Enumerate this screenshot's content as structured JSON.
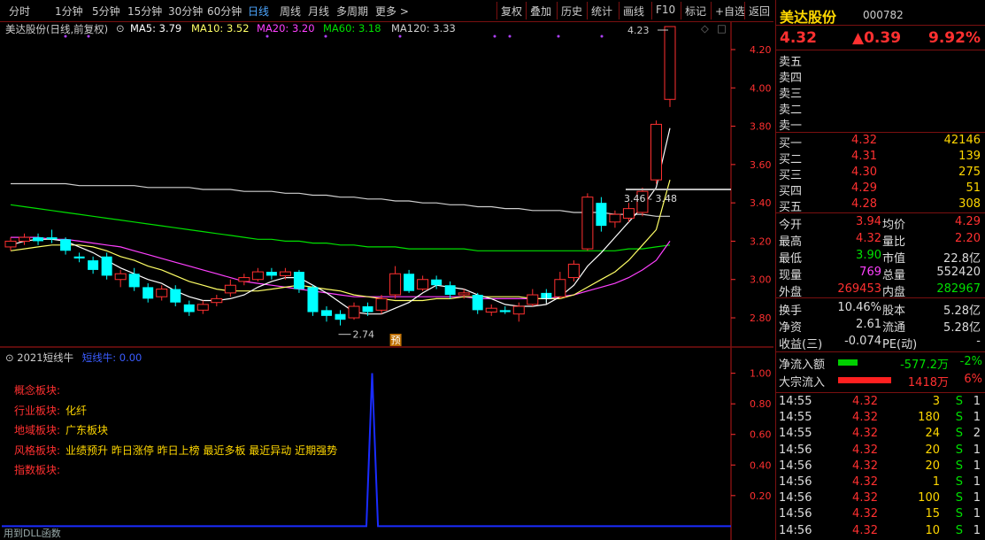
{
  "toolbar": {
    "timeframes": [
      "分时",
      "1分钟",
      "5分钟",
      "15分钟",
      "30分钟",
      "60分钟",
      "日线",
      "周线",
      "月线",
      "多周期",
      "更多 >"
    ],
    "active": "日线",
    "actions": [
      "复权",
      "叠加",
      "历史",
      "统计",
      "画线",
      "F10",
      "标记",
      "+自选",
      "返回"
    ]
  },
  "chart_title": {
    "name": "美达股份(日线,前复权)",
    "ma5": "MA5: 3.79",
    "ma10": "MA10: 3.52",
    "ma20": "MA20: 3.20",
    "ma60": "MA60: 3.18",
    "ma120": "MA120: 3.33"
  },
  "colors": {
    "up": "#ff3030",
    "down": "#00ffff",
    "ma5": "#ffffff",
    "ma10": "#ffff66",
    "ma20": "#ff40ff",
    "ma60": "#00e000",
    "ma120": "#cfcfcf",
    "panel_border": "#7a1010"
  },
  "chart_data": [
    {
      "type": "candlestick",
      "y_ticks": [
        "4.20",
        "4.00",
        "3.80",
        "3.60",
        "3.40",
        "3.20",
        "3.00",
        "2.80"
      ],
      "ylim": [
        2.68,
        4.26
      ],
      "annotations": {
        "high_label": "4.23",
        "low_label": "2.74",
        "level_label": "3.46 - 3.48",
        "marker": "预"
      },
      "candles": [
        [
          3.17,
          3.2,
          3.22,
          3.15
        ],
        [
          3.2,
          3.22,
          3.24,
          3.18
        ],
        [
          3.22,
          3.2,
          3.24,
          3.18
        ],
        [
          3.22,
          3.21,
          3.26,
          3.19
        ],
        [
          3.21,
          3.15,
          3.22,
          3.13
        ],
        [
          3.12,
          3.11,
          3.14,
          3.09
        ],
        [
          3.1,
          3.05,
          3.12,
          3.03
        ],
        [
          3.12,
          3.02,
          3.14,
          3.0
        ],
        [
          3.0,
          3.03,
          3.05,
          2.96
        ],
        [
          3.03,
          2.96,
          3.06,
          2.94
        ],
        [
          2.96,
          2.9,
          2.98,
          2.88
        ],
        [
          2.91,
          2.95,
          2.97,
          2.89
        ],
        [
          2.95,
          2.88,
          2.97,
          2.86
        ],
        [
          2.87,
          2.83,
          2.89,
          2.81
        ],
        [
          2.84,
          2.87,
          2.89,
          2.82
        ],
        [
          2.88,
          2.9,
          2.92,
          2.86
        ],
        [
          2.93,
          2.97,
          3.0,
          2.91
        ],
        [
          2.99,
          3.01,
          3.03,
          2.97
        ],
        [
          3.0,
          3.04,
          3.06,
          2.99
        ],
        [
          3.04,
          3.02,
          3.06,
          3.0
        ],
        [
          3.02,
          3.04,
          3.06,
          3.0
        ],
        [
          3.04,
          2.95,
          3.05,
          2.93
        ],
        [
          2.96,
          2.83,
          2.97,
          2.81
        ],
        [
          2.84,
          2.81,
          2.86,
          2.78
        ],
        [
          2.82,
          2.79,
          2.84,
          2.76
        ],
        [
          2.8,
          2.86,
          2.88,
          2.79
        ],
        [
          2.86,
          2.83,
          2.88,
          2.81
        ],
        [
          2.84,
          2.9,
          2.92,
          2.82
        ],
        [
          2.92,
          3.03,
          3.07,
          2.9
        ],
        [
          3.03,
          2.94,
          3.05,
          2.93
        ],
        [
          2.95,
          3.0,
          3.02,
          2.94
        ],
        [
          3.0,
          2.97,
          3.02,
          2.95
        ],
        [
          2.97,
          2.92,
          2.99,
          2.9
        ],
        [
          2.92,
          2.93,
          2.95,
          2.9
        ],
        [
          2.92,
          2.84,
          2.93,
          2.82
        ],
        [
          2.83,
          2.85,
          2.87,
          2.81
        ],
        [
          2.84,
          2.83,
          2.86,
          2.82
        ],
        [
          2.82,
          2.86,
          2.88,
          2.78
        ],
        [
          2.87,
          2.92,
          2.95,
          2.86
        ],
        [
          2.93,
          2.9,
          2.95,
          2.88
        ],
        [
          2.91,
          3.0,
          3.04,
          2.9
        ],
        [
          3.01,
          3.08,
          3.1,
          2.99
        ],
        [
          3.16,
          3.43,
          3.45,
          3.15
        ],
        [
          3.4,
          3.28,
          3.43,
          3.25
        ],
        [
          3.3,
          3.34,
          3.36,
          3.27
        ],
        [
          3.32,
          3.37,
          3.4,
          3.3
        ],
        [
          3.35,
          3.46,
          3.48,
          3.33
        ],
        [
          3.52,
          3.81,
          3.83,
          3.5
        ],
        [
          3.94,
          4.32,
          4.32,
          3.9
        ]
      ],
      "ma": {
        "ma5": [
          3.18,
          3.2,
          3.21,
          3.21,
          3.2,
          3.17,
          3.14,
          3.1,
          3.06,
          3.03,
          3.0,
          2.98,
          2.94,
          2.91,
          2.89,
          2.89,
          2.9,
          2.92,
          2.96,
          2.99,
          3.01,
          3.01,
          2.97,
          2.93,
          2.88,
          2.83,
          2.82,
          2.82,
          2.85,
          2.88,
          2.93,
          2.97,
          2.96,
          2.95,
          2.92,
          2.9,
          2.87,
          2.86,
          2.86,
          2.87,
          2.91,
          2.97,
          3.07,
          3.14,
          3.22,
          3.3,
          3.38,
          3.48,
          3.79
        ],
        "ma10": [
          3.15,
          3.16,
          3.17,
          3.18,
          3.18,
          3.18,
          3.17,
          3.15,
          3.12,
          3.1,
          3.07,
          3.05,
          3.02,
          2.99,
          2.97,
          2.95,
          2.94,
          2.94,
          2.94,
          2.95,
          2.96,
          2.97,
          2.96,
          2.95,
          2.94,
          2.92,
          2.91,
          2.9,
          2.89,
          2.89,
          2.89,
          2.9,
          2.9,
          2.91,
          2.91,
          2.91,
          2.91,
          2.91,
          2.9,
          2.9,
          2.9,
          2.92,
          2.96,
          3.0,
          3.04,
          3.1,
          3.18,
          3.26,
          3.52
        ],
        "ma20": [
          3.22,
          3.22,
          3.22,
          3.21,
          3.21,
          3.2,
          3.19,
          3.18,
          3.17,
          3.15,
          3.13,
          3.11,
          3.09,
          3.07,
          3.05,
          3.03,
          3.01,
          2.99,
          2.98,
          2.97,
          2.96,
          2.95,
          2.94,
          2.93,
          2.92,
          2.91,
          2.91,
          2.91,
          2.91,
          2.91,
          2.91,
          2.91,
          2.91,
          2.91,
          2.9,
          2.9,
          2.9,
          2.9,
          2.9,
          2.9,
          2.91,
          2.92,
          2.94,
          2.96,
          2.98,
          3.01,
          3.05,
          3.1,
          3.2
        ],
        "ma60": [
          3.39,
          3.38,
          3.37,
          3.36,
          3.35,
          3.34,
          3.33,
          3.32,
          3.31,
          3.3,
          3.29,
          3.28,
          3.27,
          3.26,
          3.25,
          3.24,
          3.23,
          3.22,
          3.21,
          3.21,
          3.2,
          3.2,
          3.19,
          3.19,
          3.18,
          3.18,
          3.17,
          3.17,
          3.17,
          3.16,
          3.16,
          3.16,
          3.16,
          3.16,
          3.15,
          3.15,
          3.15,
          3.15,
          3.15,
          3.15,
          3.15,
          3.15,
          3.15,
          3.15,
          3.15,
          3.16,
          3.16,
          3.17,
          3.18
        ],
        "ma120": [
          3.5,
          3.5,
          3.5,
          3.5,
          3.5,
          3.49,
          3.49,
          3.49,
          3.49,
          3.49,
          3.48,
          3.48,
          3.48,
          3.48,
          3.47,
          3.47,
          3.47,
          3.46,
          3.46,
          3.46,
          3.45,
          3.45,
          3.44,
          3.44,
          3.43,
          3.43,
          3.42,
          3.42,
          3.41,
          3.41,
          3.4,
          3.4,
          3.39,
          3.39,
          3.38,
          3.38,
          3.37,
          3.37,
          3.36,
          3.36,
          3.36,
          3.35,
          3.35,
          3.35,
          3.34,
          3.34,
          3.34,
          3.33,
          3.33
        ]
      }
    },
    {
      "type": "line",
      "title": "2021短线牛",
      "series_label": "短线牛: 0.00",
      "y_ticks": [
        "1.00",
        "0.80",
        "0.60",
        "0.40",
        "0.20"
      ],
      "ylim": [
        -0.05,
        1.05
      ],
      "values": [
        0,
        0,
        0,
        0,
        0,
        0,
        0,
        0,
        0,
        0,
        0,
        0,
        0,
        0,
        0,
        0,
        0,
        0,
        0,
        0,
        0,
        0,
        0,
        0,
        0,
        0,
        0,
        0,
        0,
        0,
        0,
        0,
        0,
        0,
        0,
        0,
        0,
        0,
        0,
        0,
        0,
        0,
        0,
        0,
        0,
        0,
        0,
        0,
        0,
        0,
        0,
        0,
        0,
        0,
        0,
        0,
        0,
        0,
        0,
        0,
        0,
        0,
        0,
        0,
        1,
        0,
        0,
        0,
        0,
        0,
        0,
        0,
        0,
        0,
        0,
        0,
        0,
        0,
        0,
        0,
        0,
        0,
        0,
        0,
        0,
        0,
        0,
        0,
        0,
        0,
        0,
        0,
        0,
        0,
        0,
        0,
        0,
        0,
        0,
        0,
        0,
        0,
        0,
        0,
        0,
        0,
        0,
        0,
        0,
        0,
        0,
        0,
        0,
        0,
        0,
        0,
        0,
        0,
        0,
        0,
        0,
        0,
        0,
        0,
        0,
        0,
        0
      ]
    }
  ],
  "blocks": [
    {
      "k": "概念板块:",
      "v": ""
    },
    {
      "k": "行业板块:",
      "v": "化纤"
    },
    {
      "k": "地域板块:",
      "v": "广东板块"
    },
    {
      "k": "风格板块:",
      "v": "业绩预升 昨日涨停 昨日上榜 最近多板 最近异动 近期强势"
    },
    {
      "k": "指数板块:",
      "v": ""
    }
  ],
  "footer": "用到DLL函数",
  "quote": {
    "name": "美达股份",
    "code": "000782",
    "price": "4.32",
    "change": "▲0.39",
    "pct": "9.92%",
    "asks": [
      [
        "卖五",
        "",
        ""
      ],
      [
        "卖四",
        "",
        ""
      ],
      [
        "卖三",
        "",
        ""
      ],
      [
        "卖二",
        "",
        ""
      ],
      [
        "卖一",
        "",
        ""
      ]
    ],
    "bids": [
      [
        "买一",
        "4.32",
        "42146"
      ],
      [
        "买二",
        "4.31",
        "139"
      ],
      [
        "买三",
        "4.30",
        "275"
      ],
      [
        "买四",
        "4.29",
        "51"
      ],
      [
        "买五",
        "4.28",
        "308"
      ]
    ],
    "stats": [
      [
        "今开",
        "3.94",
        "均价",
        "4.29"
      ],
      [
        "最高",
        "4.32",
        "量比",
        "2.20"
      ],
      [
        "最低",
        "3.90",
        "市值",
        "22.8亿"
      ],
      [
        "现量",
        "769",
        "总量",
        "552420"
      ],
      [
        "外盘",
        "269453",
        "内盘",
        "282967"
      ]
    ],
    "stats2": [
      [
        "换手",
        "10.46%",
        "股本",
        "5.28亿"
      ],
      [
        "净资",
        "2.61",
        "流通",
        "5.28亿"
      ],
      [
        "收益(三)",
        "-0.074",
        "PE(动)",
        "-"
      ]
    ],
    "flows": [
      {
        "label": "净流入额",
        "value": "-577.2万",
        "pct": "-2%"
      },
      {
        "label": "大宗流入",
        "value": "1418万",
        "pct": "6%"
      }
    ],
    "ticks": [
      [
        "14:55",
        "4.32",
        "3",
        "S",
        "1"
      ],
      [
        "14:55",
        "4.32",
        "180",
        "S",
        "1"
      ],
      [
        "14:55",
        "4.32",
        "24",
        "S",
        "2"
      ],
      [
        "14:56",
        "4.32",
        "20",
        "S",
        "1"
      ],
      [
        "14:56",
        "4.32",
        "20",
        "S",
        "1"
      ],
      [
        "14:56",
        "4.32",
        "1",
        "S",
        "1"
      ],
      [
        "14:56",
        "4.32",
        "100",
        "S",
        "1"
      ],
      [
        "14:56",
        "4.32",
        "15",
        "S",
        "1"
      ],
      [
        "14:56",
        "4.32",
        "10",
        "S",
        "1"
      ]
    ]
  }
}
